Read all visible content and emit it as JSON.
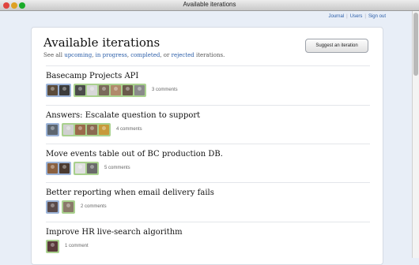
{
  "window": {
    "title": "Available iterations"
  },
  "topnav": {
    "journal": "Journal",
    "users": "Users",
    "signout": "Sign out",
    "sep": "|"
  },
  "page": {
    "title": "Available iterations",
    "subtitle": {
      "prefix": "See all ",
      "upcoming": "upcoming",
      "c1": ", ",
      "in_progress": "in progress",
      "c2": ", ",
      "completed": "completed",
      "c3": ", or ",
      "rejected": "rejected",
      "suffix": " iterations."
    },
    "suggest_label": "Suggest an iteration"
  },
  "colors": {
    "link": "#2a5da8",
    "group_blue": "#9cb4d8",
    "group_green": "#a9d18e"
  },
  "items": [
    {
      "title": "Basecamp Projects API",
      "comments": "3 comments"
    },
    {
      "title": "Answers: Escalate question to support",
      "comments": "4 comments"
    },
    {
      "title": "Move events table out of BC production DB.",
      "comments": "5 comments"
    },
    {
      "title": "Better reporting when email delivery fails",
      "comments": "2 comments"
    },
    {
      "title": "Improve HR live-search algorithm",
      "comments": "1 comment"
    }
  ]
}
